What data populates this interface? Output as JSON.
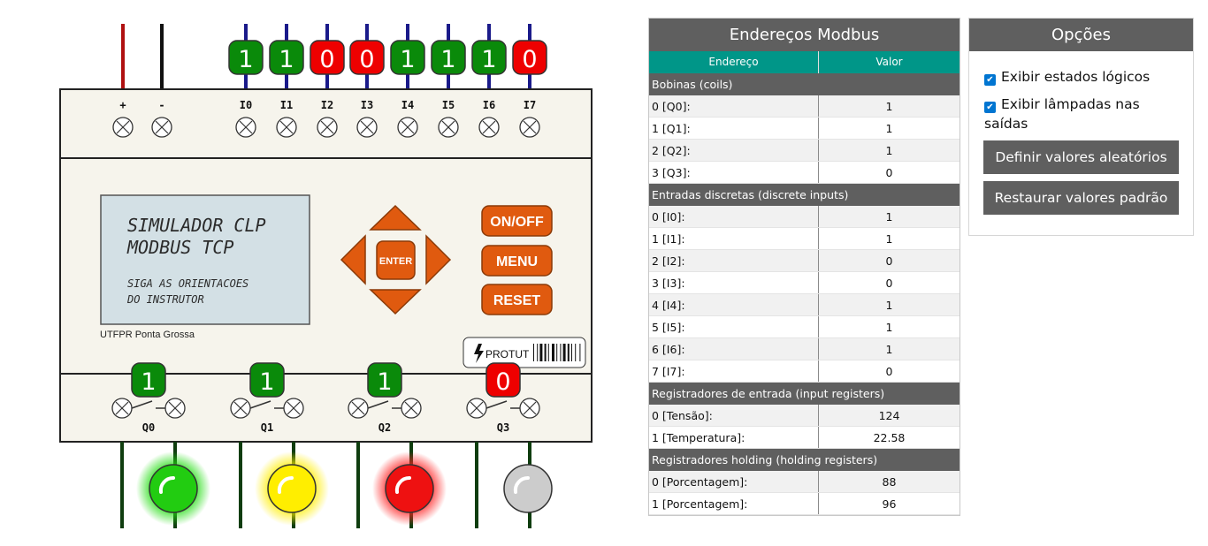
{
  "plc": {
    "power_labels": [
      "+",
      "-"
    ],
    "inputs": [
      {
        "label": "I0",
        "state": "1"
      },
      {
        "label": "I1",
        "state": "1"
      },
      {
        "label": "I2",
        "state": "0"
      },
      {
        "label": "I3",
        "state": "0"
      },
      {
        "label": "I4",
        "state": "1"
      },
      {
        "label": "I5",
        "state": "1"
      },
      {
        "label": "I6",
        "state": "1"
      },
      {
        "label": "I7",
        "state": "0"
      }
    ],
    "outputs": [
      {
        "label": "Q0",
        "state": "1",
        "lamp_color": "#22cc11"
      },
      {
        "label": "Q1",
        "state": "1",
        "lamp_color": "#ffee00"
      },
      {
        "label": "Q2",
        "state": "1",
        "lamp_color": "#ee1111"
      },
      {
        "label": "Q3",
        "state": "0",
        "lamp_color": "#cccccc"
      }
    ],
    "lcd": {
      "line1": "SIMULADOR CLP",
      "line2": "MODBUS TCP",
      "line3": "SIGA AS ORIENTACOES",
      "line4": "DO INSTRUTOR"
    },
    "brand": "UTFPR Ponta Grossa",
    "logo_text": "PROTUT",
    "buttons": {
      "onoff": "ON/OFF",
      "menu": "MENU",
      "reset": "RESET",
      "enter": "ENTER"
    },
    "colors": {
      "on": "#0a8a0a",
      "off": "#ee0000",
      "button": "#e05a0f",
      "body": "#f6f4ec"
    }
  },
  "modbus": {
    "title": "Endereços Modbus",
    "col_address": "Endereço",
    "col_value": "Valor",
    "sections": [
      {
        "title": "Bobinas (coils)",
        "rows": [
          {
            "address": "0 [Q0]:",
            "value": "1"
          },
          {
            "address": "1 [Q1]:",
            "value": "1"
          },
          {
            "address": "2 [Q2]:",
            "value": "1"
          },
          {
            "address": "3 [Q3]:",
            "value": "0"
          }
        ]
      },
      {
        "title": "Entradas discretas (discrete inputs)",
        "rows": [
          {
            "address": "0 [I0]:",
            "value": "1"
          },
          {
            "address": "1 [I1]:",
            "value": "1"
          },
          {
            "address": "2 [I2]:",
            "value": "0"
          },
          {
            "address": "3 [I3]:",
            "value": "0"
          },
          {
            "address": "4 [I4]:",
            "value": "1"
          },
          {
            "address": "5 [I5]:",
            "value": "1"
          },
          {
            "address": "6 [I6]:",
            "value": "1"
          },
          {
            "address": "7 [I7]:",
            "value": "0"
          }
        ]
      },
      {
        "title": "Registradores de entrada (input registers)",
        "rows": [
          {
            "address": "0 [Tensão]:",
            "value": "124"
          },
          {
            "address": "1 [Temperatura]:",
            "value": "22.58"
          }
        ]
      },
      {
        "title": "Registradores holding (holding registers)",
        "rows": [
          {
            "address": "0 [Porcentagem]:",
            "value": "88"
          },
          {
            "address": "1 [Porcentagem]:",
            "value": "96"
          }
        ]
      }
    ]
  },
  "options": {
    "title": "Opções",
    "show_logic_states": "Exibir estados lógicos",
    "show_lamps_line1": "Exibir lâmpadas nas",
    "show_lamps_line2": "saídas",
    "random_button": "Definir valores aleatórios",
    "reset_button": "Restaurar valores padrão"
  }
}
